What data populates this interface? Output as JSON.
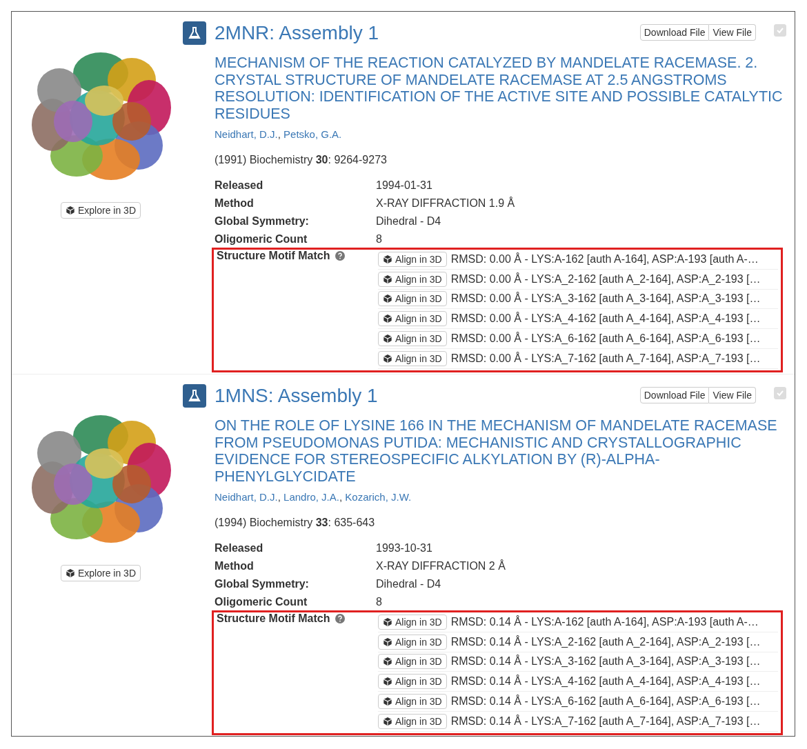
{
  "results": [
    {
      "title": "2MNR: Assembly 1",
      "download_label": "Download File",
      "view_label": "View File",
      "select": {
        "checked": true,
        "disabled": true
      },
      "explore_label": "Explore in 3D",
      "citation_title": "MECHANISM OF THE REACTION CATALYZED BY MANDELATE RACEMASE. 2. CRYSTAL STRUCTURE OF MANDELATE RACEMASE AT 2.5 ANGSTROMS RESOLUTION: IDENTIFICATION OF THE ACTIVE SITE AND POSSIBLE CATALYTIC RESIDUES",
      "authors": {
        "separator": ",",
        "names": [
          "Neidhart, D.J.",
          "Petsko, G.A."
        ]
      },
      "reference": "(1991) Biochemistry **30**: 9264-9273",
      "details": [
        {
          "label": "Released",
          "value": "1994-01-31"
        },
        {
          "label": "Method",
          "value": "X-RAY DIFFRACTION 1.9 Å"
        },
        {
          "label": "Global Symmetry:",
          "value": "Dihedral - D4"
        },
        {
          "label": "Oligomeric Count",
          "value": "8"
        }
      ],
      "motif": {
        "label": "Structure Motif Match",
        "highlighted": true,
        "matches": [
          {
            "button_label": "Align in 3D",
            "text": "RMSD: 0.00 Å - LYS:A-162 [auth A-164], ASP:A-193 [auth A-…"
          },
          {
            "button_label": "Align in 3D",
            "text": "RMSD: 0.00 Å - LYS:A_2-162 [auth A_2-164], ASP:A_2-193 […"
          },
          {
            "button_label": "Align in 3D",
            "text": "RMSD: 0.00 Å - LYS:A_3-162 [auth A_3-164], ASP:A_3-193 […"
          },
          {
            "button_label": "Align in 3D",
            "text": "RMSD: 0.00 Å - LYS:A_4-162 [auth A_4-164], ASP:A_4-193 […"
          },
          {
            "button_label": "Align in 3D",
            "text": "RMSD: 0.00 Å - LYS:A_6-162 [auth A_6-164], ASP:A_6-193 […"
          },
          {
            "button_label": "Align in 3D",
            "text": "RMSD: 0.00 Å - LYS:A_7-162 [auth A_7-164], ASP:A_7-193 […"
          }
        ]
      }
    },
    {
      "title": "1MNS: Assembly 1",
      "download_label": "Download File",
      "view_label": "View File",
      "select": {
        "checked": true,
        "disabled": true
      },
      "explore_label": "Explore in 3D",
      "citation_title": "ON THE ROLE OF LYSINE 166 IN THE MECHANISM OF MANDELATE RACEMASE FROM PSEUDOMONAS PUTIDA: MECHANISTIC AND CRYSTALLOGRAPHIC EVIDENCE FOR STEREOSPECIFIC ALKYLATION BY (R)-ALPHA-PHENYLGLYCIDATE",
      "authors": {
        "separator": ",",
        "names": [
          "Neidhart, D.J.",
          "Landro, J.A.",
          "Kozarich, J.W."
        ]
      },
      "reference": "(1994) Biochemistry **33**: 635-643",
      "details": [
        {
          "label": "Released",
          "value": "1993-10-31"
        },
        {
          "label": "Method",
          "value": "X-RAY DIFFRACTION 2 Å"
        },
        {
          "label": "Global Symmetry:",
          "value": "Dihedral - D4"
        },
        {
          "label": "Oligomeric Count",
          "value": "8"
        }
      ],
      "motif": {
        "label": "Structure Motif Match",
        "highlighted": true,
        "matches": [
          {
            "button_label": "Align in 3D",
            "text": "RMSD: 0.14 Å - LYS:A-162 [auth A-164], ASP:A-193 [auth A-…"
          },
          {
            "button_label": "Align in 3D",
            "text": "RMSD: 0.14 Å - LYS:A_2-162 [auth A_2-164], ASP:A_2-193 […"
          },
          {
            "button_label": "Align in 3D",
            "text": "RMSD: 0.14 Å - LYS:A_3-162 [auth A_3-164], ASP:A_3-193 […"
          },
          {
            "button_label": "Align in 3D",
            "text": "RMSD: 0.14 Å - LYS:A_4-162 [auth A_4-164], ASP:A_4-193 […"
          },
          {
            "button_label": "Align in 3D",
            "text": "RMSD: 0.14 Å - LYS:A_6-162 [auth A_6-164], ASP:A_6-193 […"
          },
          {
            "button_label": "Align in 3D",
            "text": "RMSD: 0.14 Å - LYS:A_7-162 [auth A_7-164], ASP:A_7-193 […"
          }
        ]
      }
    }
  ]
}
